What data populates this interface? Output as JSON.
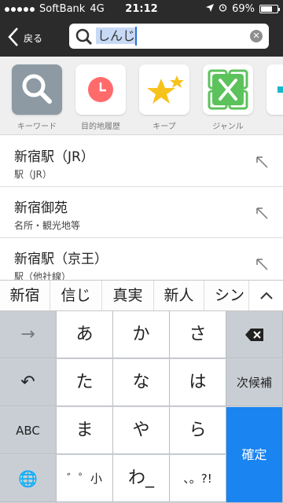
{
  "status": {
    "carrier": "SoftBank",
    "network": "4G",
    "time": "21:12",
    "battery_text": "69%",
    "battery_level": 0.69
  },
  "nav": {
    "back_label": "戻る",
    "search_query": "しんじ"
  },
  "categories": [
    {
      "label": "キーワード",
      "icon": "magnifier-icon"
    },
    {
      "label": "目的地履歴",
      "icon": "clock-icon"
    },
    {
      "label": "キープ",
      "icon": "stars-icon"
    },
    {
      "label": "ジャンル",
      "icon": "utensils-icon"
    }
  ],
  "results": [
    {
      "title": "新宿駅（JR）",
      "subtitle": "駅（JR）"
    },
    {
      "title": "新宿御苑",
      "subtitle": "名所・観光地等"
    },
    {
      "title": "新宿駅（京王）",
      "subtitle": "駅（他社線）"
    }
  ],
  "candidates": [
    "新宿",
    "信じ",
    "真実",
    "新人",
    "シン"
  ],
  "keyboard": {
    "row1": [
      "→",
      "あ",
      "か",
      "さ",
      "⌫"
    ],
    "row2": [
      "↶",
      "た",
      "な",
      "は",
      "次候補"
    ],
    "row3": [
      "ABC",
      "ま",
      "や",
      "ら",
      "確定"
    ],
    "row4": [
      "🌐",
      "゛゜小",
      "わ_",
      "、。?!"
    ]
  },
  "colors": {
    "bar": "#2b2b2b",
    "accent_blue": "#1a84f0",
    "keyboard_bg": "#d1d5db"
  }
}
